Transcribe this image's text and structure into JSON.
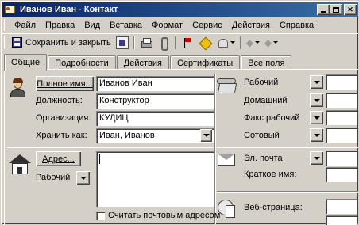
{
  "window": {
    "title": "Иванов Иван - Контакт"
  },
  "menu": [
    "Файл",
    "Правка",
    "Вид",
    "Вставка",
    "Формат",
    "Сервис",
    "Действия",
    "Справка"
  ],
  "toolbar": {
    "save_close": "Сохранить и закрыть"
  },
  "tabs": [
    "Общие",
    "Подробности",
    "Действия",
    "Сертификаты",
    "Все поля"
  ],
  "general": {
    "fullname_button": "Полное имя...",
    "fullname_value": "Иванов Иван",
    "position_label": "Должность:",
    "position_value": "Конструктор",
    "organization_label": "Организация:",
    "organization_value": "КУДИЦ",
    "fileas_label": "Хранить как:",
    "fileas_value": "Иван, Иванов",
    "address_button": "Адрес...",
    "address_type": "Рабочий",
    "mailing_checkbox": "Считать почтовым адресом"
  },
  "phones": [
    {
      "label": "Рабочий"
    },
    {
      "label": "Домашний"
    },
    {
      "label": "Факс рабочий"
    },
    {
      "label": "Сотовый"
    }
  ],
  "email": {
    "label": "Эл. почта",
    "short_name_label": "Краткое имя:"
  },
  "web": {
    "label": "Веб-страница:"
  }
}
